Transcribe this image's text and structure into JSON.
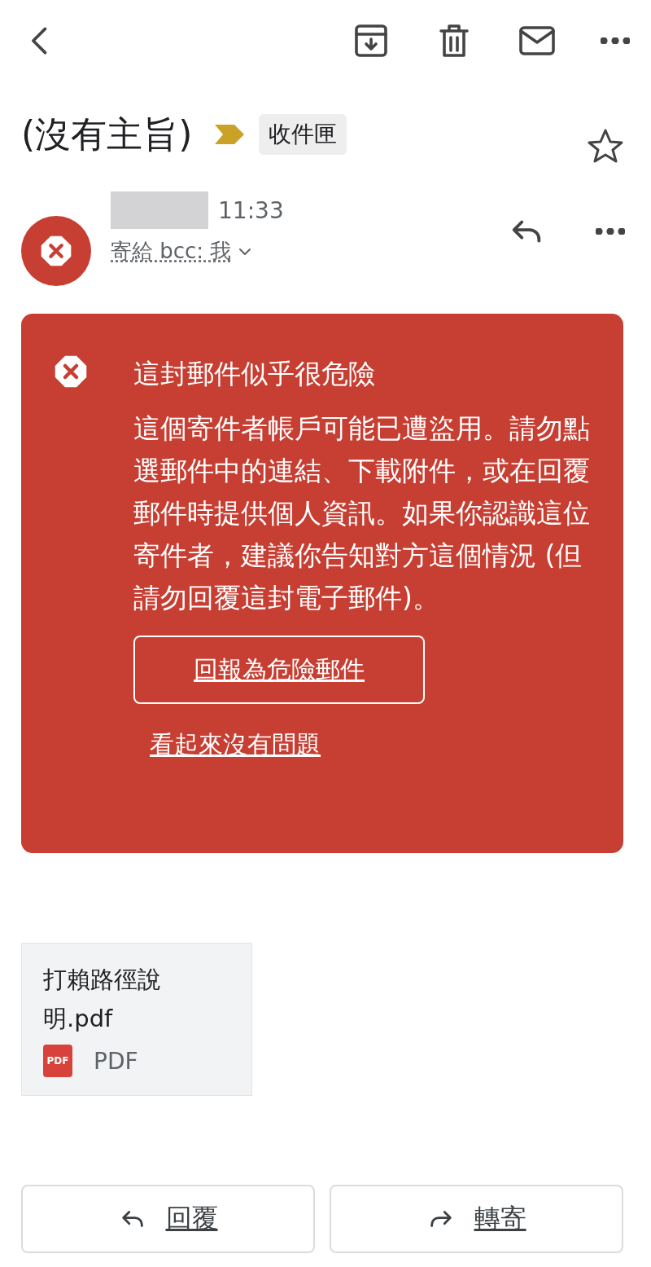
{
  "subject": {
    "title": "(沒有主旨)",
    "important": true,
    "label": "收件匣",
    "starred": false
  },
  "message": {
    "time": "11:33",
    "recipients": "寄給 bcc: 我"
  },
  "warning": {
    "title": "這封郵件似乎很危險",
    "body": "這個寄件者帳戶可能已遭盜用。請勿點選郵件中的連結、下載附件，或在回覆郵件時提供個人資訊。如果你認識這位寄件者，建議你告知對方這個情況 (但請勿回覆這封電子郵件)。",
    "report_button": "回報為危險郵件",
    "dismiss_link": "看起來沒有問題"
  },
  "attachment": {
    "name": "打賴路徑說明.pdf",
    "icon_text": "PDF",
    "type": "PDF"
  },
  "actions": [
    {
      "kind": "reply",
      "label": "回覆"
    },
    {
      "kind": "forward",
      "label": "轉寄"
    }
  ]
}
